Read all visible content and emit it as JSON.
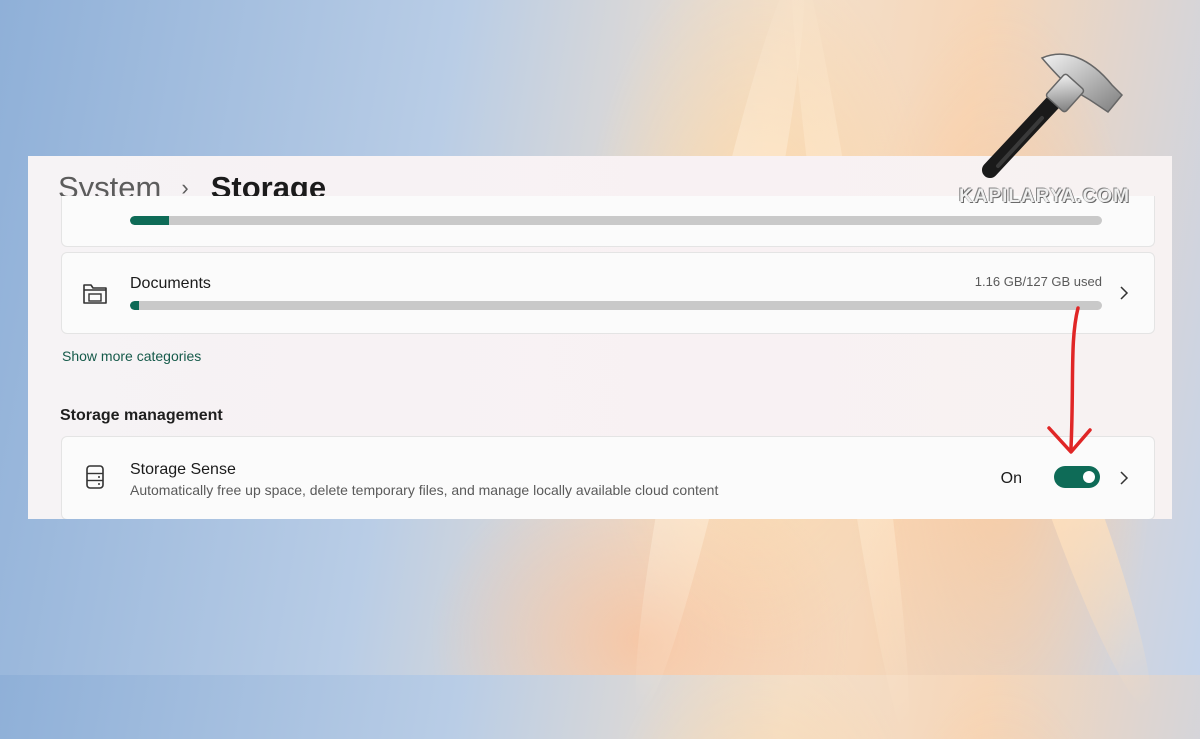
{
  "breadcrumb": {
    "parent": "System",
    "separator": "›",
    "current": "Storage"
  },
  "categories": {
    "partial_row": {
      "usage_fraction": 0.04
    },
    "documents": {
      "label": "Documents",
      "usage_text": "1.16 GB/127 GB used",
      "usage_fraction": 0.009,
      "icon": "folder-icon"
    },
    "show_more_label": "Show more categories"
  },
  "storage_management": {
    "heading": "Storage management",
    "storage_sense": {
      "title": "Storage Sense",
      "description": "Automatically free up space, delete temporary files, and manage locally available cloud content",
      "state_label": "On",
      "toggle_on": true,
      "icon": "storage-drive-icon"
    }
  },
  "watermark": {
    "logo": "hammer-icon",
    "text": "KAPILARYA.COM"
  },
  "annotation": {
    "arrow_color": "#e02626"
  },
  "colors": {
    "accent": "#0e6b57",
    "bar_track": "#c9c9c9"
  }
}
